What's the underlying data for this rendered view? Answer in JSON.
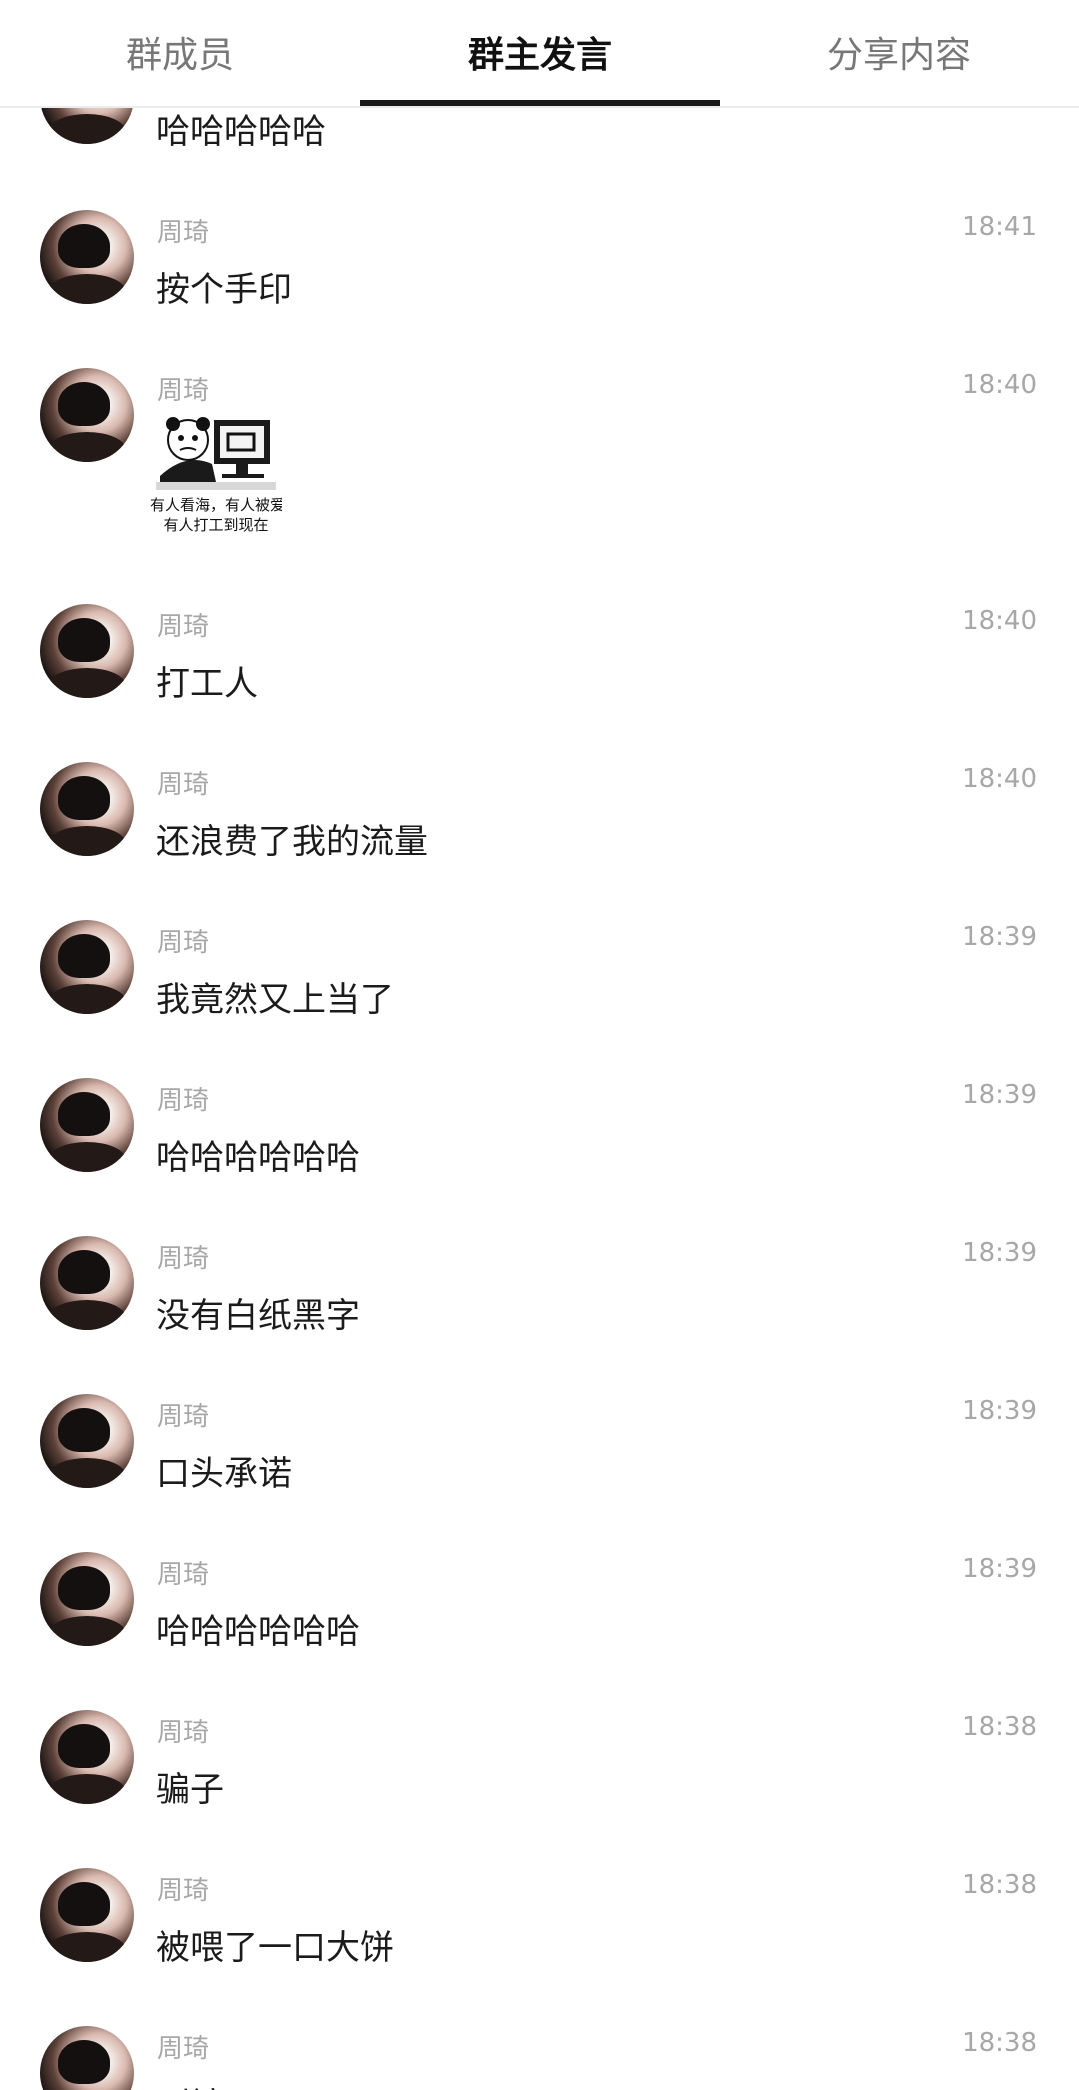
{
  "tabs": [
    {
      "label": "群成员",
      "active": false
    },
    {
      "label": "群主发言",
      "active": true
    },
    {
      "label": "分享内容",
      "active": false
    }
  ],
  "messages": [
    {
      "sender": "",
      "time": "",
      "text": "哈哈哈哈哈",
      "type": "text"
    },
    {
      "sender": "周琦",
      "time": "18:41",
      "text": "按个手印",
      "type": "text"
    },
    {
      "sender": "周琦",
      "time": "18:40",
      "type": "sticker",
      "sticker_caption": [
        "有人看海，有人被爱",
        "有人打工到现在"
      ]
    },
    {
      "sender": "周琦",
      "time": "18:40",
      "text": "打工人",
      "type": "text"
    },
    {
      "sender": "周琦",
      "time": "18:40",
      "text": "还浪费了我的流量",
      "type": "text"
    },
    {
      "sender": "周琦",
      "time": "18:39",
      "text": "我竟然又上当了",
      "type": "text"
    },
    {
      "sender": "周琦",
      "time": "18:39",
      "text": "哈哈哈哈哈哈",
      "type": "text"
    },
    {
      "sender": "周琦",
      "time": "18:39",
      "text": "没有白纸黑字",
      "type": "text"
    },
    {
      "sender": "周琦",
      "time": "18:39",
      "text": "口头承诺",
      "type": "text"
    },
    {
      "sender": "周琦",
      "time": "18:39",
      "text": "哈哈哈哈哈哈",
      "type": "text"
    },
    {
      "sender": "周琦",
      "time": "18:38",
      "text": "骗子",
      "type": "text"
    },
    {
      "sender": "周琦",
      "time": "18:38",
      "text": "被喂了一口大饼",
      "type": "text"
    },
    {
      "sender": "周琦",
      "time": "18:38",
      "text": "到镜了",
      "type": "text"
    }
  ]
}
